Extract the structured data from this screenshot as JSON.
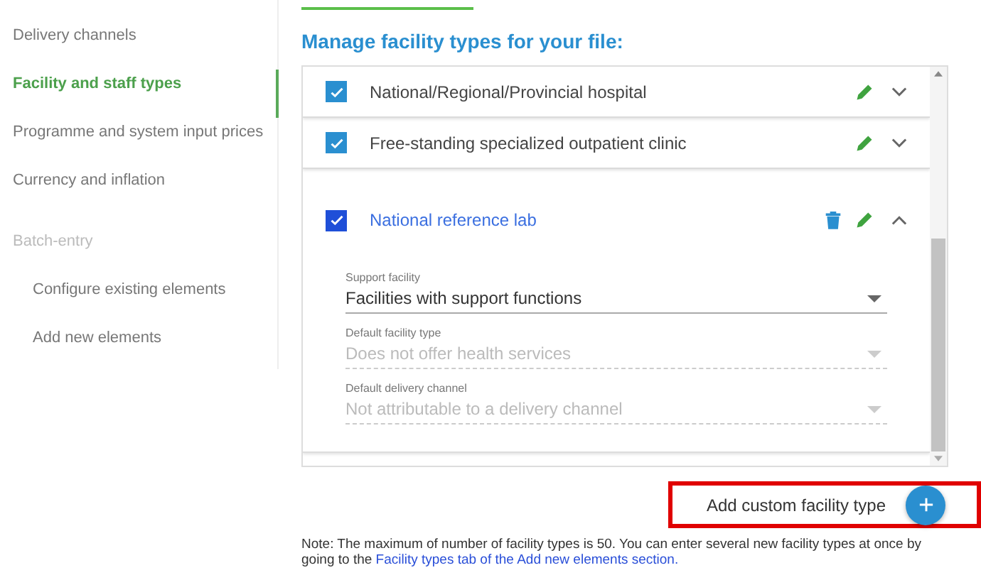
{
  "sidebar": {
    "items": [
      {
        "label": "Delivery channels",
        "selected": false,
        "disabled": false
      },
      {
        "label": "Facility and staff types",
        "selected": true,
        "disabled": false
      },
      {
        "label": "Programme and system input prices",
        "selected": false,
        "disabled": false
      },
      {
        "label": "Currency and inflation",
        "selected": false,
        "disabled": false
      },
      {
        "label": "Batch-entry",
        "selected": false,
        "disabled": true,
        "children": [
          {
            "label": "Configure existing elements",
            "selected": false,
            "disabled": false
          },
          {
            "label": "Add new elements",
            "selected": false,
            "disabled": false
          }
        ]
      }
    ]
  },
  "heading": "Manage facility types for your file:",
  "facility_types": [
    {
      "name": "National/Regional/Provincial hospital",
      "checked": true,
      "expanded": false
    },
    {
      "name": "Free-standing specialized outpatient clinic",
      "checked": true,
      "expanded": false
    },
    {
      "name": "National reference lab",
      "checked": true,
      "expanded": true,
      "fields": [
        {
          "label": "Support facility",
          "value": "Facilities with support functions",
          "disabled": false
        },
        {
          "label": "Default facility type",
          "value": "Does not offer health services",
          "disabled": true
        },
        {
          "label": "Default delivery channel",
          "value": "Not attributable to a delivery channel",
          "disabled": true
        }
      ]
    }
  ],
  "add_button": {
    "label": "Add custom facility type",
    "highlighted": true
  },
  "note": {
    "text": "Note: The maximum of number of facility types is 50. You can enter several new facility types at once by going to the ",
    "link": "Facility types tab of the Add new elements section."
  }
}
